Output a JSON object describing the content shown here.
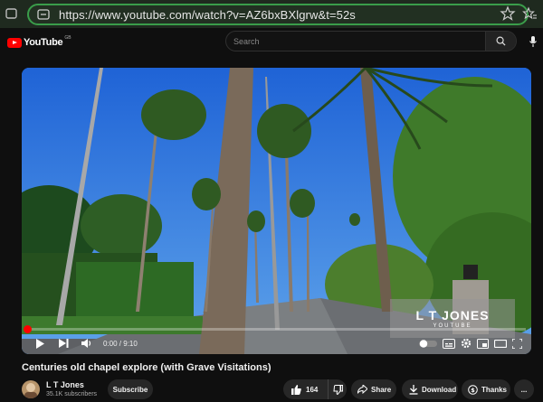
{
  "browser": {
    "url": "https://www.youtube.com/watch?v=AZ6bxBXlgrw&t=52s",
    "icons": [
      "tune-icon",
      "star-icon",
      "favorites-icon"
    ]
  },
  "header": {
    "logo_text": "YouTube",
    "country_code": "GB",
    "search_placeholder": "Search"
  },
  "player": {
    "time": "0:00 / 9:10",
    "progress_fraction": 0.0,
    "watermark_title": "L T JONES",
    "watermark_sub": "YOUTUBE"
  },
  "video": {
    "title": "Centuries old chapel explore (with Grave Visitations)",
    "channel": "L T Jones",
    "subscribers": "35.1K subscribers",
    "subscribe_label": "Subscribe",
    "likes": "164",
    "share_label": "Share",
    "download_label": "Download",
    "thanks_label": "Thanks",
    "more_label": "..."
  },
  "colors": {
    "accent": "#ff0000",
    "address_border": "#3a9d4a",
    "page_bg": "#0f0f0f"
  }
}
